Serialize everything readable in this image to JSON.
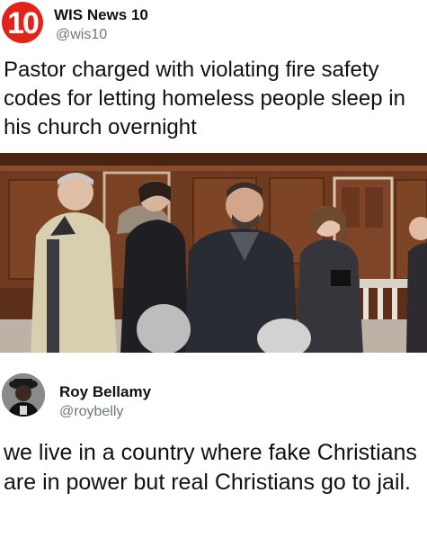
{
  "top_post": {
    "avatar_icon": "wis-news-10-logo-icon",
    "avatar_logo_text": "10",
    "display_name": "WIS News 10",
    "handle": "@wis10",
    "headline": "Pastor charged with violating fire safety codes for letting homeless people sleep in his church overnight",
    "photo_icon": "courtroom-photo"
  },
  "bottom_post": {
    "avatar_icon": "roy-bellamy-avatar-icon",
    "display_name": "Roy Bellamy",
    "handle": "@roybelly",
    "text": "we live in a country where fake Christians are in power but real Christians go to jail."
  },
  "colors": {
    "brand_red": "#e2231a",
    "handle_gray": "#6b7780",
    "wood_paneling": "#6b3a22"
  }
}
